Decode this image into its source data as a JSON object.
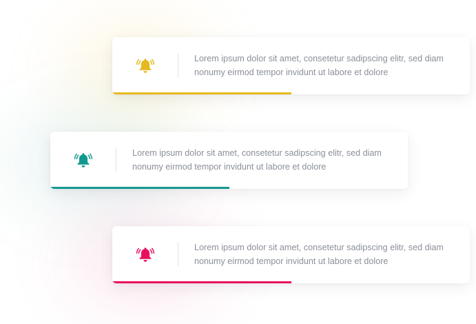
{
  "notifications": [
    {
      "icon": "bell-icon",
      "color": "#e6b91e",
      "line1": "Lorem ipsum dolor sit amet, consetetur sadipscing elitr, sed diam",
      "line2": "nonumy eirmod tempor invidunt ut labore et dolore",
      "progress_fraction": 0.5
    },
    {
      "icon": "bell-icon",
      "color": "#13988f",
      "line1": "Lorem ipsum dolor sit amet, consetetur sadipscing elitr, sed diam",
      "line2": "nonumy eirmod tempor invidunt ut labore et dolore",
      "progress_fraction": 0.5
    },
    {
      "icon": "bell-icon",
      "color": "#e8105e",
      "line1": "Lorem ipsum dolor sit amet, consetetur sadipscing elitr, sed diam",
      "line2": "nonumy eirmod tempor invidunt ut labore et dolore",
      "progress_fraction": 0.5
    }
  ]
}
